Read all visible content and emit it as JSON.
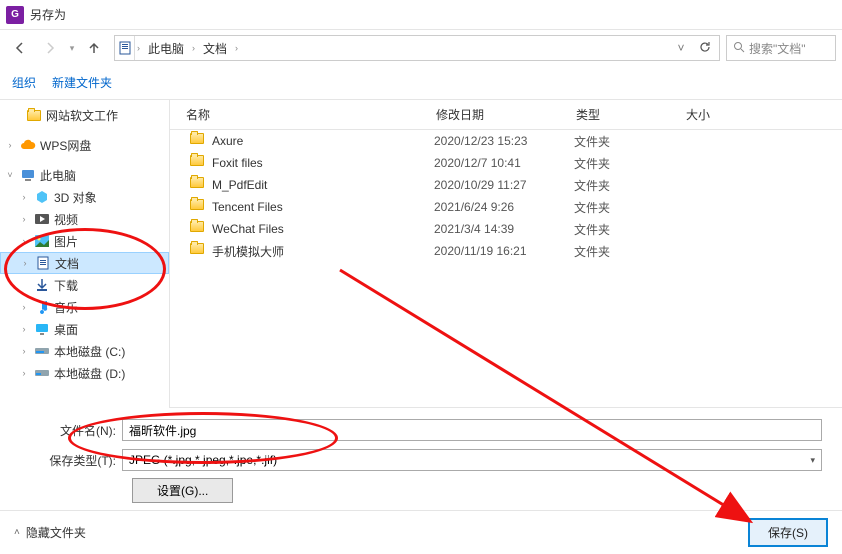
{
  "window": {
    "title": "另存为"
  },
  "breadcrumb": {
    "seg1": "此电脑",
    "seg2": "文档"
  },
  "search": {
    "placeholder": "搜索\"文档\""
  },
  "toolbar": {
    "organize": "组织",
    "newfolder": "新建文件夹"
  },
  "columns": {
    "name": "名称",
    "date": "修改日期",
    "type": "类型",
    "size": "大小"
  },
  "tree": {
    "item_website": "网站软文工作",
    "wps": "WPS网盘",
    "thispc": "此电脑",
    "obj3d": "3D 对象",
    "videos": "视频",
    "pictures": "图片",
    "documents": "文档",
    "downloads": "下载",
    "music": "音乐",
    "desktop": "桌面",
    "diskC": "本地磁盘 (C:)",
    "diskD": "本地磁盘 (D:)"
  },
  "files": [
    {
      "name": "Axure",
      "date": "2020/12/23 15:23",
      "type": "文件夹"
    },
    {
      "name": "Foxit files",
      "date": "2020/12/7 10:41",
      "type": "文件夹"
    },
    {
      "name": "M_PdfEdit",
      "date": "2020/10/29 11:27",
      "type": "文件夹"
    },
    {
      "name": "Tencent Files",
      "date": "2021/6/24 9:26",
      "type": "文件夹"
    },
    {
      "name": "WeChat Files",
      "date": "2021/3/4 14:39",
      "type": "文件夹"
    },
    {
      "name": "手机模拟大师",
      "date": "2020/11/19 16:21",
      "type": "文件夹"
    }
  ],
  "form": {
    "filename_label": "文件名(N):",
    "filename_value": "福昕软件.jpg",
    "savetype_label": "保存类型(T):",
    "savetype_value": "JPEG (*.jpg,*.jpeg,*.jpe,*.jif)",
    "settings_label": "设置(G)..."
  },
  "footer": {
    "hide_folders": "隐藏文件夹",
    "save": "保存(S)"
  }
}
